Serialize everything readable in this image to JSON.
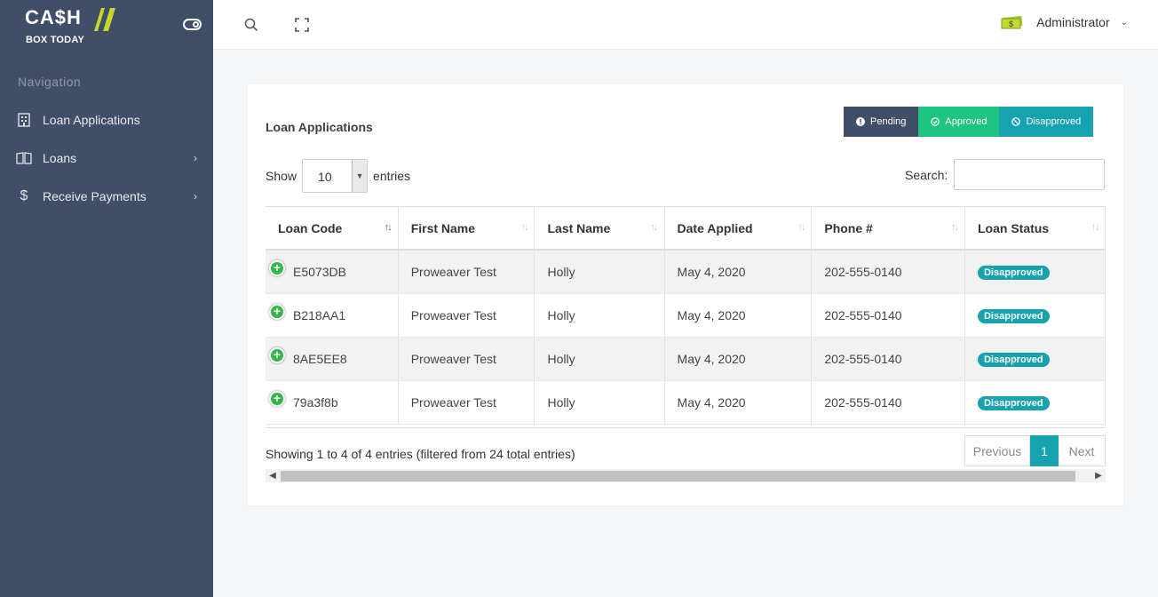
{
  "brand": {
    "top": "CA$H",
    "bottom": "BOX TODAY"
  },
  "nav": {
    "caption": "Navigation",
    "items": [
      {
        "label": "Loan Applications",
        "icon": "building-icon",
        "chevron": ""
      },
      {
        "label": "Loans",
        "icon": "book-icon",
        "chevron": "›"
      },
      {
        "label": "Receive Payments",
        "icon": "dollar-icon",
        "chevron": "›"
      }
    ]
  },
  "topbar": {
    "user_name": "Administrator",
    "caret": "⌄"
  },
  "card": {
    "title": "Loan Applications"
  },
  "filters": {
    "pending": "Pending",
    "approved": "Approved",
    "disapproved": "Disapproved"
  },
  "length": {
    "show": "Show",
    "value": "10",
    "entries": "entries"
  },
  "search": {
    "label": "Search:",
    "value": ""
  },
  "table": {
    "columns": [
      "Loan Code",
      "First Name",
      "Last Name",
      "Date Applied",
      "Phone #",
      "Loan Status"
    ],
    "rows": [
      {
        "code": "E5073DB",
        "first": "Proweaver Test",
        "last": "Holly",
        "date": "May 4, 2020",
        "phone": "202-555-0140",
        "status": "Disapproved"
      },
      {
        "code": "B218AA1",
        "first": "Proweaver Test",
        "last": "Holly",
        "date": "May 4, 2020",
        "phone": "202-555-0140",
        "status": "Disapproved"
      },
      {
        "code": "8AE5EE8",
        "first": "Proweaver Test",
        "last": "Holly",
        "date": "May 4, 2020",
        "phone": "202-555-0140",
        "status": "Disapproved"
      },
      {
        "code": "79a3f8b",
        "first": "Proweaver Test",
        "last": "Holly",
        "date": "May 4, 2020",
        "phone": "202-555-0140",
        "status": "Disapproved"
      }
    ]
  },
  "info": "Showing 1 to 4 of 4 entries (filtered from 24 total entries)",
  "pager": {
    "prev": "Previous",
    "current": "1",
    "next": "Next"
  },
  "colors": {
    "sidebar": "#404e67",
    "approved": "#1ec481",
    "teal": "#17a2b0"
  }
}
